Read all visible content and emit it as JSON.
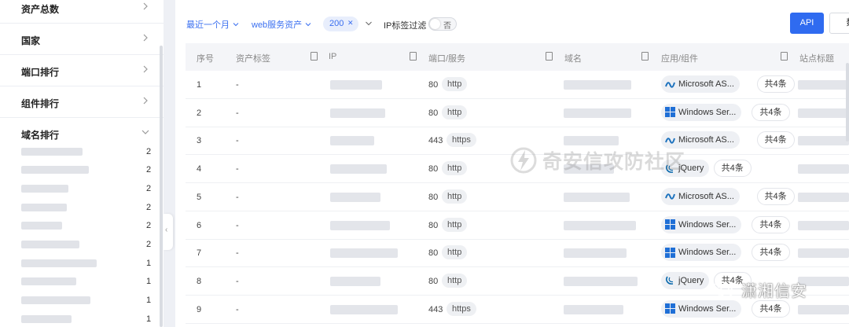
{
  "sidebar": {
    "sections": [
      {
        "id": "asset-total",
        "title": "资产总数",
        "expanded": false
      },
      {
        "id": "country",
        "title": "国家",
        "expanded": false
      },
      {
        "id": "port-rank",
        "title": "端口排行",
        "expanded": false
      },
      {
        "id": "component-rank",
        "title": "组件排行",
        "expanded": false
      },
      {
        "id": "domain-rank",
        "title": "域名排行",
        "expanded": true
      }
    ],
    "domain_counts": [
      "2",
      "2",
      "2",
      "2",
      "2",
      "2",
      "1",
      "1",
      "1",
      "1"
    ]
  },
  "filters": {
    "time_range": "最近一个月",
    "asset_type": "web服务资产",
    "status_chip": "200",
    "ip_tag_filter_label": "IP标签过滤",
    "ip_tag_filter_state": "否"
  },
  "toolbar": {
    "api_label": "API",
    "data_label": "数"
  },
  "table": {
    "headers": {
      "index": "序号",
      "asset_tag": "资产标签",
      "ip": "IP",
      "port_service": "端口/服务",
      "domain": "域名",
      "app_component": "应用/组件",
      "site_title": "站点标题"
    },
    "rows": [
      {
        "index": "1",
        "tag": "-",
        "port": "80",
        "service": "http",
        "component": "Microsoft AS...",
        "component_icon": "dotnet-icon",
        "more": "共4条"
      },
      {
        "index": "2",
        "tag": "-",
        "port": "80",
        "service": "http",
        "component": "Windows Ser...",
        "component_icon": "windows-icon",
        "more": "共4条"
      },
      {
        "index": "3",
        "tag": "-",
        "port": "443",
        "service": "https",
        "component": "Microsoft AS...",
        "component_icon": "dotnet-icon",
        "more": "共4条"
      },
      {
        "index": "4",
        "tag": "-",
        "port": "80",
        "service": "http",
        "component": "jQuery",
        "component_icon": "jquery-icon",
        "more": "共4条"
      },
      {
        "index": "5",
        "tag": "-",
        "port": "80",
        "service": "http",
        "component": "Microsoft AS...",
        "component_icon": "dotnet-icon",
        "more": "共4条"
      },
      {
        "index": "6",
        "tag": "-",
        "port": "80",
        "service": "http",
        "component": "Windows Ser...",
        "component_icon": "windows-icon",
        "more": "共4条"
      },
      {
        "index": "7",
        "tag": "-",
        "port": "80",
        "service": "http",
        "component": "Windows Ser...",
        "component_icon": "windows-icon",
        "more": "共4条"
      },
      {
        "index": "8",
        "tag": "-",
        "port": "80",
        "service": "http",
        "component": "jQuery",
        "component_icon": "jquery-icon",
        "more": "共4条"
      },
      {
        "index": "9",
        "tag": "-",
        "port": "443",
        "service": "https",
        "component": "Windows Ser...",
        "component_icon": "windows-icon",
        "more": "共4条"
      }
    ]
  },
  "watermarks": {
    "center": "奇安信攻防社区",
    "corner": "潇湘信安"
  },
  "colors": {
    "accent": "#2f6bf0",
    "chip_bg": "#e8eefc",
    "windows_blue": "#1f6fd6",
    "jquery_blue": "#0868ac"
  }
}
